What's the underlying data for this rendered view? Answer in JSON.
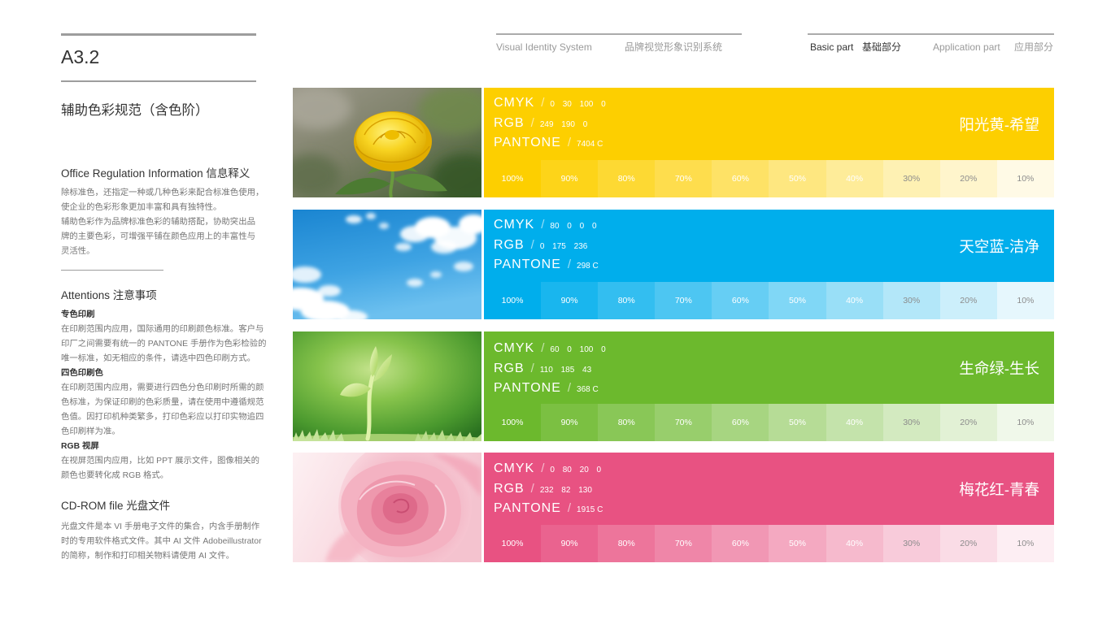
{
  "page": {
    "code": "A3.2",
    "title": "辅助色彩规范（含色阶）"
  },
  "header": {
    "system_en": "Visual Identity System",
    "system_cn": "品牌视觉形象识别系统",
    "basic_en": "Basic part",
    "basic_cn": "基础部分",
    "application_en": "Application part",
    "application_cn": "应用部分"
  },
  "info": {
    "heading": "Office Regulation Information 信息释义",
    "lines": [
      "除标准色，还指定一种或几种色彩来配合标准色使用，",
      "使企业的色彩形象更加丰富和具有独特性。",
      "辅助色彩作为品牌标准色彩的辅助搭配，协助突出品",
      "牌的主要色彩，可增强平铺在颜色应用上的丰富性与",
      "灵活性。"
    ]
  },
  "attentions": {
    "heading": "Attentions 注意事项",
    "spot": {
      "title": "专色印刷",
      "lines": [
        "在印刷范围内应用，国际通用的印刷颜色标准。客户与",
        "印厂之间需要有统一的 PANTONE 手册作为色彩检验的",
        "唯一标准，如无相应的条件，请选中四色印刷方式。"
      ]
    },
    "four_color": {
      "title": "四色印刷色",
      "lines": [
        "在印刷范围内应用，需要进行四色分色印刷时所需的颜",
        "色标准，为保证印刷的色彩质量，请在使用中遵循规范",
        "色值。因打印机种类繁多，打印色彩应以打印实物追四",
        "色印刷样为准。"
      ]
    },
    "rgb": {
      "title": "RGB 视屏",
      "lines": [
        "在视屏范围内应用，比如 PPT 展示文件，图像相关的",
        "颜色也要转化成 RGB 格式。"
      ]
    }
  },
  "cdrom": {
    "heading": "CD-ROM file 光盘文件",
    "lines": [
      "光盘文件是本 VI 手册电子文件的集合，内含手册制作",
      "时的专用软件格式文件。其中 AI 文件 Adobeillustrator",
      "的简称，制作和打印相关物料请使用 AI 文件。"
    ]
  },
  "swatch_labels": {
    "cmyk": "CMYK",
    "rgb": "RGB",
    "pantone": "PANTONE",
    "separator": "/"
  },
  "tint_labels": [
    "100%",
    "90%",
    "80%",
    "70%",
    "60%",
    "50%",
    "40%",
    "30%",
    "20%",
    "10%"
  ],
  "colors": [
    {
      "name": "阳光黄-希望",
      "hex": "#FDCF00",
      "cmyk": "0 30 100 0",
      "rgb": "249 190 0",
      "pantone": "7404 C",
      "photo": "yellow-rose"
    },
    {
      "name": "天空蓝-洁净",
      "hex": "#00AEEC",
      "cmyk": "80 0 0 0",
      "rgb": "0 175 236",
      "pantone": "298 C",
      "photo": "blue-sky-clouds"
    },
    {
      "name": "生命绿-生长",
      "hex": "#6CB92D",
      "cmyk": "60 0 100 0",
      "rgb": "110 185 43",
      "pantone": "368 C",
      "photo": "green-sprout"
    },
    {
      "name": "梅花红-青春",
      "hex": "#E85282",
      "cmyk": "0 80 20 0",
      "rgb": "232 82 130",
      "pantone": "1915 C",
      "photo": "pink-rose"
    }
  ]
}
